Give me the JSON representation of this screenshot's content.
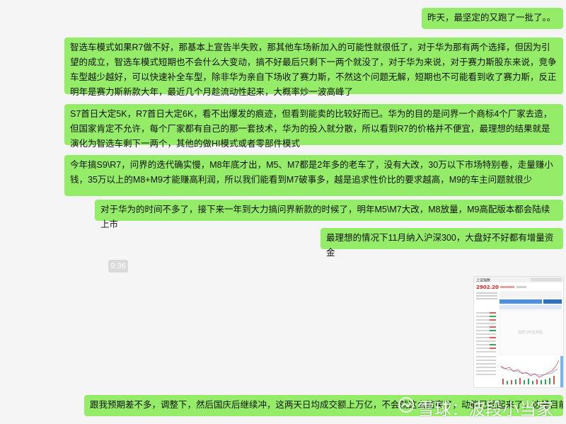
{
  "messages": [
    "昨天，最坚定的又跑了一批了。。",
    "智选车模式如果R7做不好，那基本上宣告半失败，那其他车场新加入的可能性就很低了，对于华为那有两个选择，但因为引望的成立，智选车模式短期也不会什么大变动，搞不好最后只剩下一两个就没了，对于华为来说，对于赛力斯股东来说，竞争车型越少越好，可以快速补全车型，除非华为亲自下场收了赛力斯，不然这个问题无解，短期也不可能看到收了赛力斯，反正明年是赛力斯新款大年，最近几个月趁流动性起来，大概率炒一波高峰了",
    "S7首日大定5K，R7首日大定6K，看不出爆发的痕迹，但看到能卖的比较好而已。华为的目的是问界一个商标4个厂家去造，但国家肯定不允许，每个厂家都有自己的那一套技术，华为的投入就分散，所以看到R7的价格并不便宜，最理想的结果就是演化为智选车剩下一两个，其他的做HI模式或者零部件模式",
    "今年搞S9\\R7，问界的迭代确实慢，M8年底才出，M5、M7都是2年多的老车了，没有大改，30万以下市场特别卷，走量赚小钱，35万以上的M8+M9才能赚高利润，所以我们能看到M7破事多，越是追求性价比的要求越高，M9的车主问题就很少",
    "对于华为的时间不多了，接下来一年到大力搞问界新款的时候了，明年M5\\M7大改，M8放量，M9高配版本都会陆续上市",
    "最理想的情况下11月纳入沪深300，大盘好不好都有增量资金",
    "跟我预期差不多，调整下，然后国庆后继续冲，这两天日均成交额上万亿，不会就这么结束了，动能已经起来了，这是目前我最看好的"
  ],
  "time_label": "9:36",
  "thumbnail": {
    "header_text": "上证指数",
    "price": "2902.20",
    "panel_note": "指数分时走势图"
  },
  "watermark": {
    "text": "雪球：波段小当家"
  },
  "colors": {
    "bubble": "#95ec69",
    "background": "#f5f5f5",
    "time_pill": "#dadada"
  }
}
